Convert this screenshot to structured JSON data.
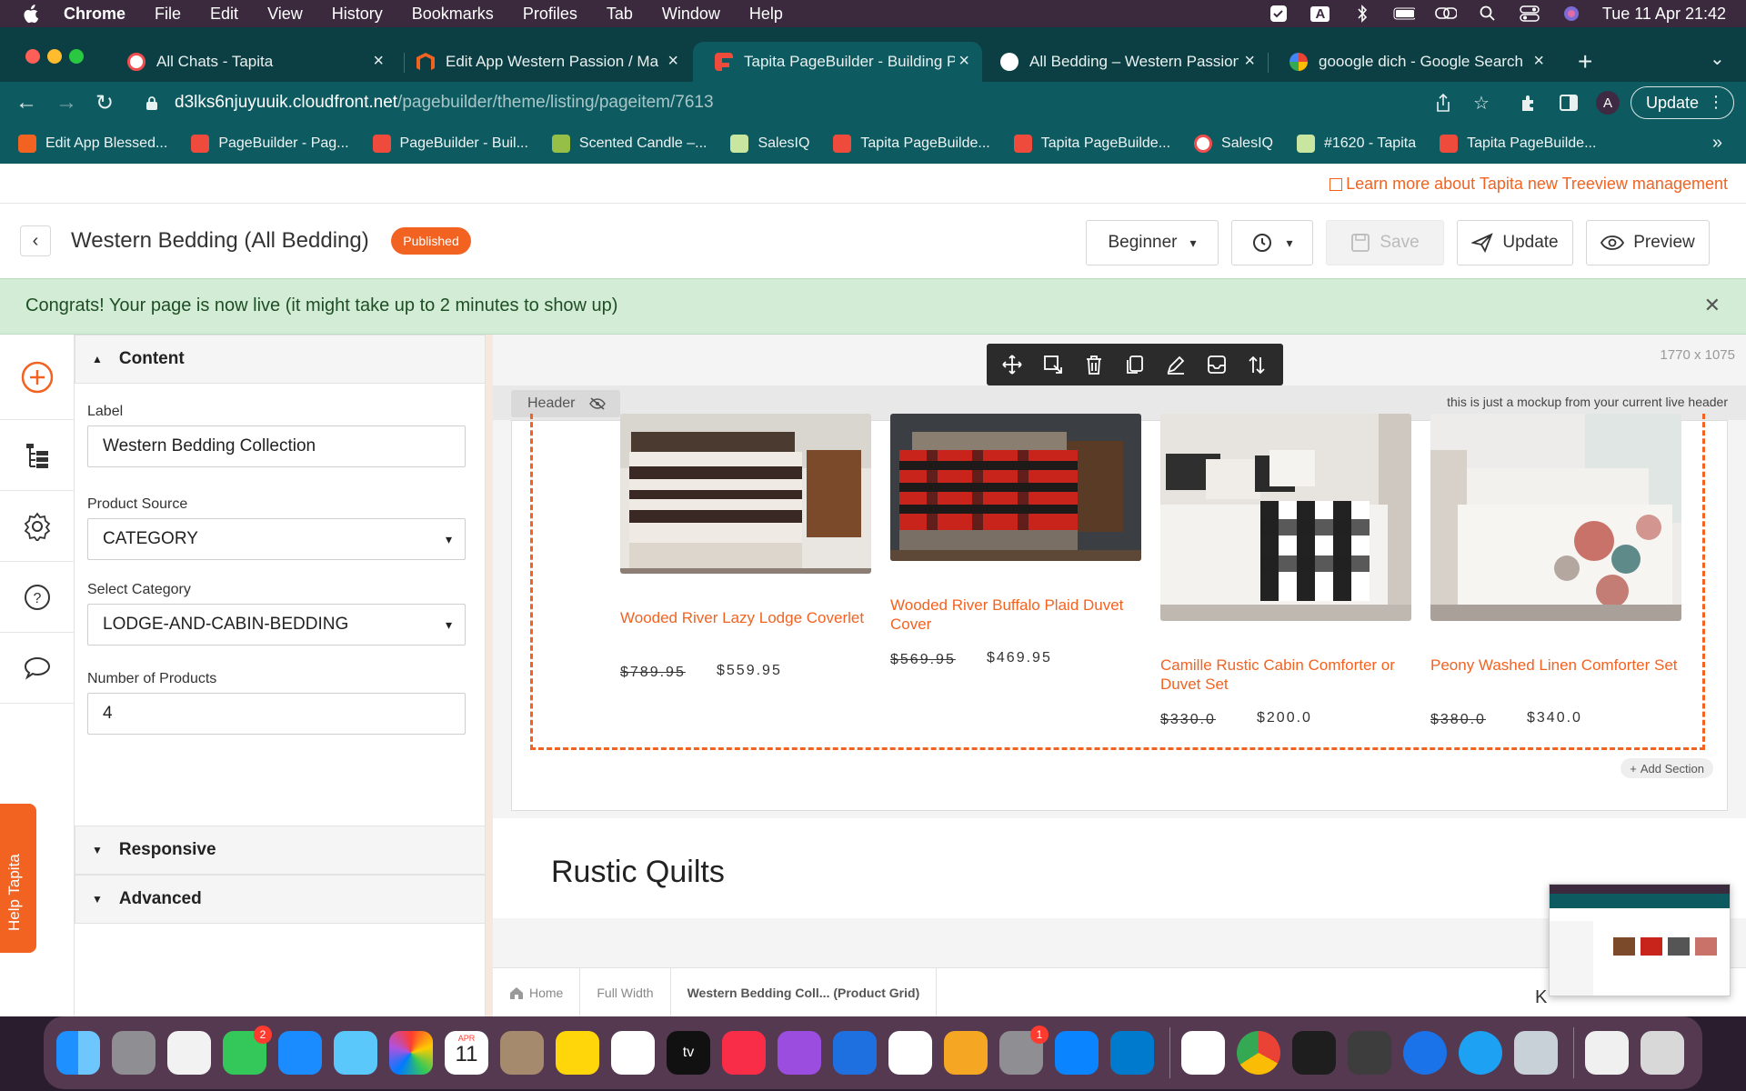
{
  "menubar": {
    "app": "Chrome",
    "items": [
      "File",
      "Edit",
      "View",
      "History",
      "Bookmarks",
      "Profiles",
      "Tab",
      "Window",
      "Help"
    ],
    "input_source": "A",
    "clock": "Tue 11 Apr  21:42"
  },
  "tabs": [
    {
      "label": "All Chats - Tapita",
      "icon": "tapita-icon",
      "color": "#f04e4e",
      "active": false
    },
    {
      "label": "Edit App Western Passion / Ma",
      "icon": "magento-icon",
      "color": "#f26322",
      "active": false
    },
    {
      "label": "Tapita PageBuilder - Building P",
      "icon": "pagebuilder-icon",
      "color": "#ef4b3c",
      "active": true
    },
    {
      "label": "All Bedding – Western Passion",
      "icon": "globe-icon",
      "color": "#ffffff",
      "active": false
    },
    {
      "label": "gooogle dich - Google Search",
      "icon": "google-icon",
      "color": "#ffffff",
      "active": false
    }
  ],
  "address": {
    "host": "d3lks6njuyuuik.cloudfront.net",
    "path": "/pagebuilder/theme/listing/pageitem/7613",
    "avatar": "A",
    "update_label": "Update"
  },
  "bookmarks": [
    {
      "label": "Edit App Blessed...",
      "color": "#f26322"
    },
    {
      "label": "PageBuilder - Pag...",
      "color": "#ef4b3c"
    },
    {
      "label": "PageBuilder - Buil...",
      "color": "#ef4b3c"
    },
    {
      "label": "Scented Candle –...",
      "color": "#95bf47"
    },
    {
      "label": "SalesIQ",
      "color": "#c8e6a0"
    },
    {
      "label": "Tapita PageBuilde...",
      "color": "#ef4b3c"
    },
    {
      "label": "Tapita PageBuilde...",
      "color": "#ef4b3c"
    },
    {
      "label": "SalesIQ",
      "color": "#f04e4e"
    },
    {
      "label": "#1620 - Tapita",
      "color": "#c8e6a0"
    },
    {
      "label": "Tapita PageBuilde...",
      "color": "#ef4b3c"
    }
  ],
  "learn_link": "Learn more about Tapita new Treeview management",
  "header": {
    "title": "Western Bedding (All Bedding)",
    "status": "Published",
    "mode": "Beginner",
    "save": "Save",
    "update": "Update",
    "preview": "Preview"
  },
  "congrats": "Congrats! Your page is now live (it might take up to 2 minutes to show up)",
  "panel": {
    "content_title": "Content",
    "label_label": "Label",
    "label_value": "Western Bedding Collection",
    "source_label": "Product Source",
    "source_value": "CATEGORY",
    "category_label": "Select Category",
    "category_value": "LODGE-AND-CABIN-BEDDING",
    "count_label": "Number of Products",
    "count_value": "4",
    "responsive": "Responsive",
    "advanced": "Advanced"
  },
  "help_tab": "Help Tapita",
  "canvas": {
    "dims": "1770 x 1075",
    "header_tag": "Header",
    "header_note": "this is just a mockup from your current live header",
    "add_section": "Add Section",
    "next_title": "Rustic Quilts"
  },
  "products": [
    {
      "name": "Wooded River Lazy Lodge Coverlet",
      "old": "$789.95",
      "new": "$559.95"
    },
    {
      "name": "Wooded River Buffalo Plaid Duvet Cover",
      "old": "$569.95",
      "new": "$469.95"
    },
    {
      "name": "Camille Rustic Cabin Comforter or Duvet Set",
      "old": "$330.0",
      "new": "$200.0"
    },
    {
      "name": "Peony Washed Linen Comforter Set",
      "old": "$380.0",
      "new": "$340.0"
    }
  ],
  "breadcrumb": [
    "Home",
    "Full Width",
    "Western Bedding Coll... (Product Grid)"
  ],
  "dock": {
    "calendar_month": "APR",
    "calendar_day": "11",
    "messages_badge": "2",
    "settings_badge": "1"
  },
  "colors": {
    "accent": "#f26322",
    "chrome": "#0d5b61",
    "success_bg": "#d3ecd5"
  }
}
